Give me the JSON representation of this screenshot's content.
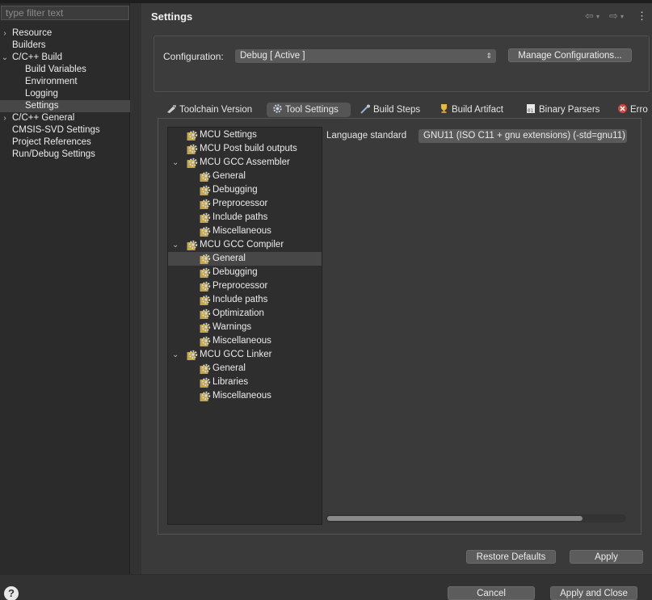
{
  "filter": {
    "placeholder": "type filter text"
  },
  "left_tree": [
    {
      "label": "Resource",
      "chev": "›",
      "indent": 0
    },
    {
      "label": "Builders",
      "chev": "",
      "indent": 0
    },
    {
      "label": "C/C++ Build",
      "chev": "⌄",
      "indent": 0
    },
    {
      "label": "Build Variables",
      "chev": "",
      "indent": 1
    },
    {
      "label": "Environment",
      "chev": "",
      "indent": 1
    },
    {
      "label": "Logging",
      "chev": "",
      "indent": 1
    },
    {
      "label": "Settings",
      "chev": "",
      "indent": 1,
      "selected": true
    },
    {
      "label": "C/C++ General",
      "chev": "›",
      "indent": 0
    },
    {
      "label": "CMSIS-SVD Settings",
      "chev": "",
      "indent": 0
    },
    {
      "label": "Project References",
      "chev": "",
      "indent": 0
    },
    {
      "label": "Run/Debug Settings",
      "chev": "",
      "indent": 0
    }
  ],
  "page_title": "Settings",
  "config": {
    "label": "Configuration:",
    "value": "Debug  [ Active ]",
    "manage_button": "Manage Configurations..."
  },
  "tabs": [
    {
      "label": "Toolchain Version",
      "icon": "toolchain-icon"
    },
    {
      "label": "Tool Settings",
      "icon": "gear-icon",
      "active": true
    },
    {
      "label": "Build Steps",
      "icon": "build-steps-icon"
    },
    {
      "label": "Build Artifact",
      "icon": "trophy-icon"
    },
    {
      "label": "Binary Parsers",
      "icon": "binary-icon"
    },
    {
      "label": "Erro",
      "icon": "error-icon"
    }
  ],
  "tool_tree": [
    {
      "label": "MCU Settings",
      "level": 0,
      "chev": ""
    },
    {
      "label": "MCU Post build outputs",
      "level": 0,
      "chev": ""
    },
    {
      "label": "MCU GCC Assembler",
      "level": 0,
      "chev": "⌄"
    },
    {
      "label": "General",
      "level": 1
    },
    {
      "label": "Debugging",
      "level": 1
    },
    {
      "label": "Preprocessor",
      "level": 1
    },
    {
      "label": "Include paths",
      "level": 1
    },
    {
      "label": "Miscellaneous",
      "level": 1
    },
    {
      "label": "MCU GCC Compiler",
      "level": 0,
      "chev": "⌄"
    },
    {
      "label": "General",
      "level": 1,
      "selected": true
    },
    {
      "label": "Debugging",
      "level": 1
    },
    {
      "label": "Preprocessor",
      "level": 1
    },
    {
      "label": "Include paths",
      "level": 1
    },
    {
      "label": "Optimization",
      "level": 1
    },
    {
      "label": "Warnings",
      "level": 1
    },
    {
      "label": "Miscellaneous",
      "level": 1
    },
    {
      "label": "MCU GCC Linker",
      "level": 0,
      "chev": "⌄"
    },
    {
      "label": "General",
      "level": 1
    },
    {
      "label": "Libraries",
      "level": 1
    },
    {
      "label": "Miscellaneous",
      "level": 1
    }
  ],
  "language": {
    "label": "Language standard",
    "value": "GNU11 (ISO C11 + gnu extensions) (-std=gnu11)"
  },
  "buttons": {
    "restore_defaults": "Restore Defaults",
    "apply": "Apply",
    "cancel": "Cancel",
    "apply_and_close": "Apply and Close"
  },
  "help": "?"
}
